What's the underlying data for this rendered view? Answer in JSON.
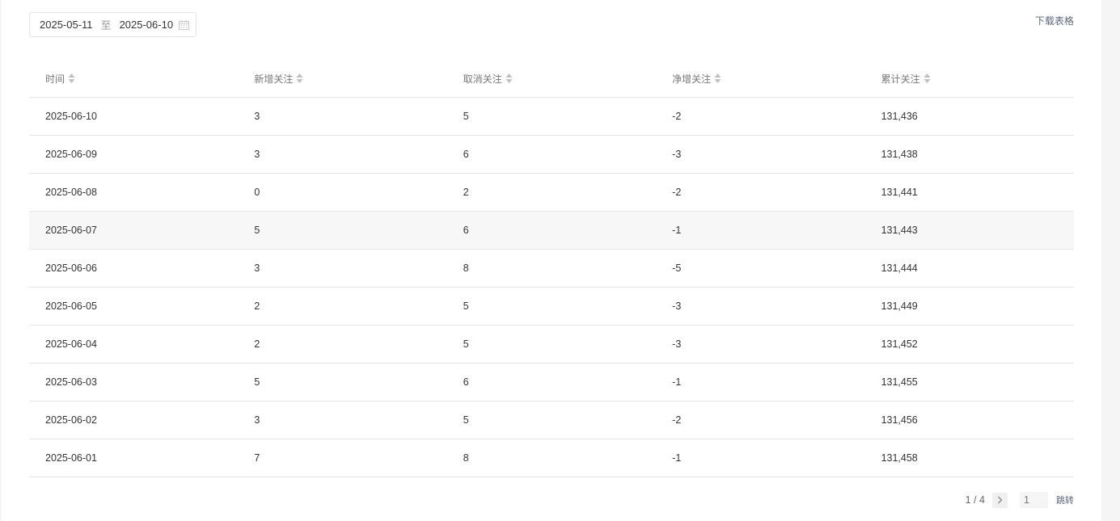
{
  "date_range": {
    "start": "2025-05-11",
    "separator": "至",
    "end": "2025-06-10"
  },
  "actions": {
    "download_label": "下载表格"
  },
  "table": {
    "columns": [
      "时间",
      "新增关注",
      "取消关注",
      "净增关注",
      "累计关注"
    ],
    "rows": [
      [
        "2025-06-10",
        "3",
        "5",
        "-2",
        "131,436"
      ],
      [
        "2025-06-09",
        "3",
        "6",
        "-3",
        "131,438"
      ],
      [
        "2025-06-08",
        "0",
        "2",
        "-2",
        "131,441"
      ],
      [
        "2025-06-07",
        "5",
        "6",
        "-1",
        "131,443"
      ],
      [
        "2025-06-06",
        "3",
        "8",
        "-5",
        "131,444"
      ],
      [
        "2025-06-05",
        "2",
        "5",
        "-3",
        "131,449"
      ],
      [
        "2025-06-04",
        "2",
        "5",
        "-3",
        "131,452"
      ],
      [
        "2025-06-03",
        "5",
        "6",
        "-1",
        "131,455"
      ],
      [
        "2025-06-02",
        "3",
        "5",
        "-2",
        "131,456"
      ],
      [
        "2025-06-01",
        "7",
        "8",
        "-1",
        "131,458"
      ]
    ]
  },
  "pagination": {
    "page_info": "1 / 4",
    "jump_input_placeholder": "1",
    "jump_label": "跳转"
  }
}
